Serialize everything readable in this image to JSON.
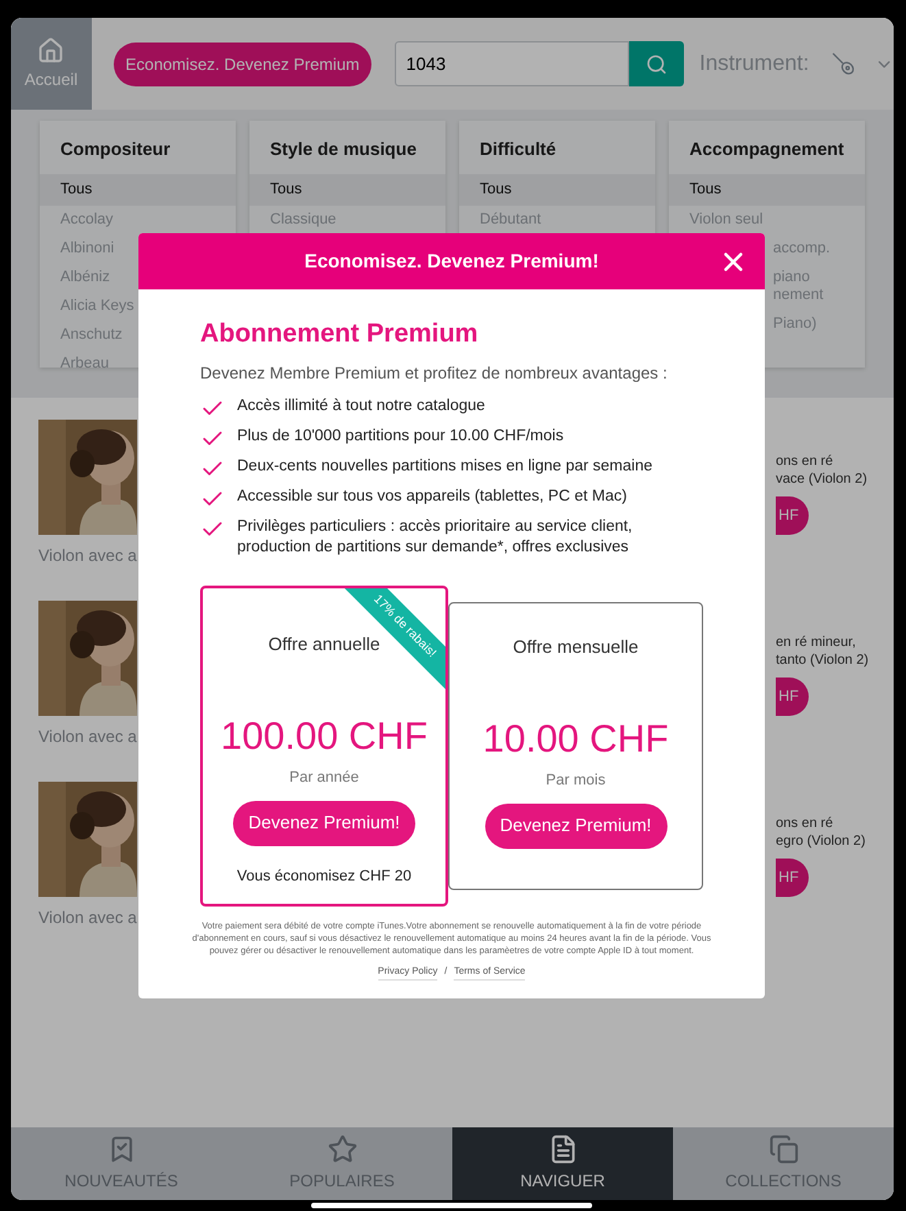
{
  "header": {
    "home": {
      "label": "Accueil"
    },
    "premium_button": "Economisez. Devenez Premium",
    "search": {
      "value": "1043"
    },
    "instrument_label": "Instrument:"
  },
  "filters": [
    {
      "title": "Compositeur",
      "items": [
        {
          "label": "Tous",
          "selected": true,
          "kind": "full"
        },
        {
          "label": "Accolay",
          "selected": false,
          "kind": "full"
        },
        {
          "label": "Albinoni",
          "selected": false,
          "kind": "full"
        },
        {
          "label": "Albéniz",
          "selected": false,
          "kind": "full"
        },
        {
          "label": "Alicia Keys",
          "selected": false,
          "kind": "full"
        },
        {
          "label": "Anschutz",
          "selected": false,
          "kind": "full"
        },
        {
          "label": "Arbeau",
          "selected": false,
          "kind": "full"
        }
      ]
    },
    {
      "title": "Style de musique",
      "items": [
        {
          "label": "Tous",
          "selected": true,
          "kind": "full"
        },
        {
          "label": "Classique",
          "selected": false,
          "kind": "full"
        }
      ]
    },
    {
      "title": "Difficulté",
      "items": [
        {
          "label": "Tous",
          "selected": true,
          "kind": "full"
        },
        {
          "label": "Débutant",
          "selected": false,
          "kind": "full"
        }
      ]
    },
    {
      "title": "Accompagnement",
      "items": [
        {
          "label": "Tous",
          "selected": true,
          "kind": "full"
        },
        {
          "label": "Violon seul",
          "selected": false,
          "kind": "full"
        },
        {
          "label": "accomp.",
          "selected": false,
          "kind": "cut"
        },
        {
          "label": "piano\nnement",
          "selected": false,
          "kind": "cut"
        },
        {
          "label": "Piano)",
          "selected": false,
          "kind": "cut"
        }
      ]
    }
  ],
  "results": [
    {
      "kind": "picture",
      "caption": "Violon avec a",
      "title": "ons en ré\nvace (Violon 2)",
      "price": "HF"
    },
    {
      "kind": "picture",
      "caption": "Violon avec a",
      "title": "en ré mineur,\ntanto (Violon 2)",
      "price": "HF"
    },
    {
      "kind": "picture",
      "caption": "Violon avec a",
      "title": "ons en ré\negro (Violon 2)",
      "price": "HF"
    }
  ],
  "modal": {
    "title": "Economisez. Devenez Premium!",
    "heading": "Abonnement Premium",
    "intro": "Devenez Membre Premium et profitez de nombreux avantages :",
    "features": [
      "Accès illimité à tout notre catalogue",
      "Plus de 10'000 partitions pour 10.00 CHF/mois",
      "Deux-cents nouvelles partitions mises en ligne par semaine",
      "Accessible sur tous vos appareils (tablettes, PC et Mac)",
      "Privilèges particuliers : accès prioritaire au service client,\nproduction de partitions sur demande*, offres exclusives"
    ],
    "offers": [
      {
        "name": "Offre annuelle",
        "price": "100.00 CHF",
        "period": "Par année",
        "button": "Devenez Premium!",
        "savings": "Vous économisez CHF 20",
        "ribbon": "17% de rabais!",
        "selected": true
      },
      {
        "name": "Offre mensuelle",
        "price": "10.00 CHF",
        "period": "Par mois",
        "button": "Devenez Premium!",
        "selected": false
      }
    ],
    "legal": "Votre paiement sera débité de votre compte iTunes.Votre abonnement se renouvelle automatiquement à la fin de votre période d'abonnement en cours, sauf si vous désactivez le renouvellement automatique au moins 24 heures avant la fin de la période. Vous pouvez gérer ou désactiver le renouvellement automatique dans les paramèetres de votre compte Apple ID à tout moment.",
    "links": [
      "Privacy Policy",
      "Terms of Service"
    ],
    "link_separator": "/"
  },
  "tabs": [
    {
      "label": "NOUVEAUTÉS",
      "selected": false
    },
    {
      "label": "POPULAIRES",
      "selected": false
    },
    {
      "label": "NAVIGUER",
      "selected": true
    },
    {
      "label": "COLLECTIONS",
      "selected": false
    }
  ]
}
